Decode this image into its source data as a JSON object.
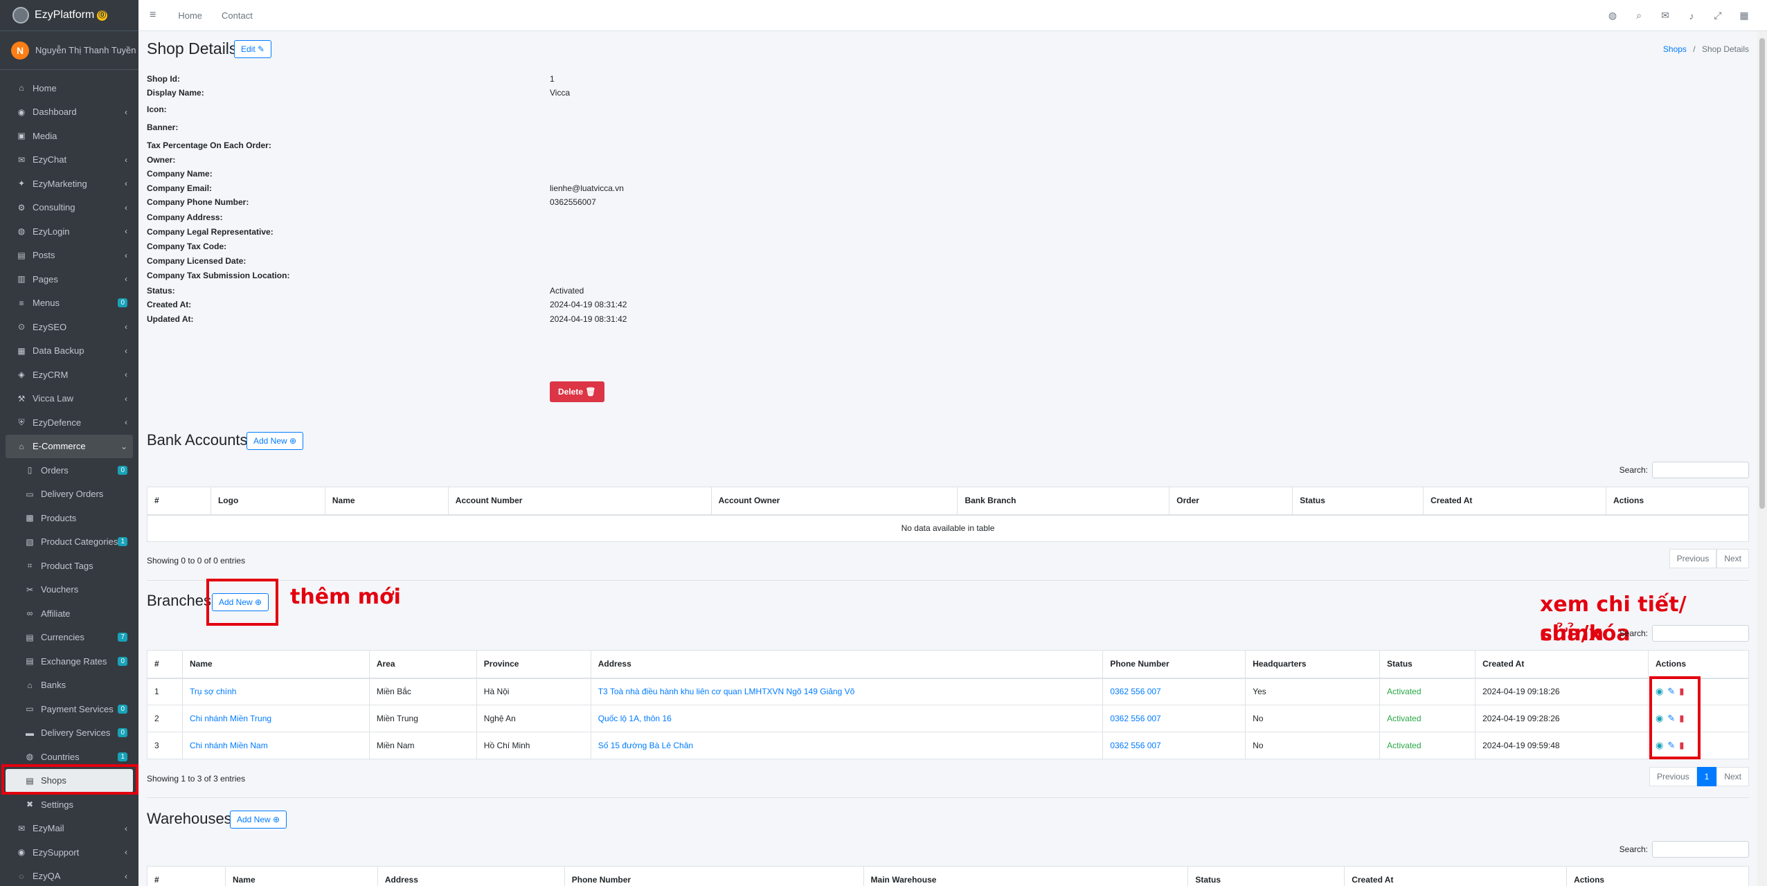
{
  "brand": {
    "name": "EzyPlatform",
    "badge": "⓪"
  },
  "user": {
    "initial": "N",
    "name": "Nguyễn Thị Thanh Tuyền"
  },
  "sidebar": [
    {
      "label": "Home",
      "icon": "home-icon",
      "glyph": "⌂",
      "type": "top"
    },
    {
      "label": "Dashboard",
      "icon": "dashboard-icon",
      "glyph": "◉",
      "type": "top",
      "chev": "‹"
    },
    {
      "label": "Media",
      "icon": "image-icon",
      "glyph": "▣",
      "type": "top"
    },
    {
      "label": "EzyChat",
      "icon": "chat-icon",
      "glyph": "✉",
      "type": "top",
      "chev": "‹"
    },
    {
      "label": "EzyMarketing",
      "icon": "megaphone-icon",
      "glyph": "✦",
      "type": "top",
      "chev": "‹"
    },
    {
      "label": "Consulting",
      "icon": "gear-icon",
      "glyph": "⚙",
      "type": "top",
      "chev": "‹"
    },
    {
      "label": "EzyLogin",
      "icon": "user-lock-icon",
      "glyph": "◍",
      "type": "top",
      "chev": "‹"
    },
    {
      "label": "Posts",
      "icon": "post-icon",
      "glyph": "▤",
      "type": "top",
      "chev": "‹"
    },
    {
      "label": "Pages",
      "icon": "pages-icon",
      "glyph": "▥",
      "type": "top",
      "chev": "‹"
    },
    {
      "label": "Menus",
      "icon": "menu-icon",
      "glyph": "≡",
      "type": "top",
      "badge": "0"
    },
    {
      "label": "EzySEO",
      "icon": "seo-search-icon",
      "glyph": "⊙",
      "type": "top",
      "chev": "‹"
    },
    {
      "label": "Data Backup",
      "icon": "database-icon",
      "glyph": "▦",
      "type": "top",
      "chev": "‹"
    },
    {
      "label": "EzyCRM",
      "icon": "crm-icon",
      "glyph": "◈",
      "type": "top",
      "chev": "‹"
    },
    {
      "label": "Vicca Law",
      "icon": "gavel-icon",
      "glyph": "⚒",
      "type": "top",
      "chev": "‹"
    },
    {
      "label": "EzyDefence",
      "icon": "shield-icon",
      "glyph": "⛨",
      "type": "top",
      "chev": "‹"
    },
    {
      "label": "E-Commerce",
      "icon": "shop-basket-icon",
      "glyph": "⌂",
      "type": "open",
      "chev": "⌄"
    },
    {
      "label": "Orders",
      "icon": "orders-icon",
      "glyph": "▯",
      "type": "sub",
      "badge": "0"
    },
    {
      "label": "Delivery Orders",
      "icon": "delivery-orders-icon",
      "glyph": "▭",
      "type": "sub"
    },
    {
      "label": "Products",
      "icon": "products-icon",
      "glyph": "▩",
      "type": "sub"
    },
    {
      "label": "Product Categories",
      "icon": "categories-icon",
      "glyph": "▧",
      "type": "sub",
      "badge": "1"
    },
    {
      "label": "Product Tags",
      "icon": "tag-icon",
      "glyph": "⌗",
      "type": "sub"
    },
    {
      "label": "Vouchers",
      "icon": "voucher-icon",
      "glyph": "✂",
      "type": "sub"
    },
    {
      "label": "Affiliate",
      "icon": "link-icon",
      "glyph": "∞",
      "type": "sub"
    },
    {
      "label": "Currencies",
      "icon": "currency-icon",
      "glyph": "▤",
      "type": "sub",
      "badge": "7"
    },
    {
      "label": "Exchange Rates",
      "icon": "exchange-icon",
      "glyph": "▤",
      "type": "sub",
      "badge": "0"
    },
    {
      "label": "Banks",
      "icon": "bank-icon",
      "glyph": "⌂",
      "type": "sub"
    },
    {
      "label": "Payment Services",
      "icon": "payment-icon",
      "glyph": "▭",
      "type": "sub",
      "badge": "0"
    },
    {
      "label": "Delivery Services",
      "icon": "truck-icon",
      "glyph": "▬",
      "type": "sub",
      "badge": "0"
    },
    {
      "label": "Countries",
      "icon": "globe-icon",
      "glyph": "◍",
      "type": "sub",
      "badge": "1"
    },
    {
      "label": "Shops",
      "icon": "store-icon",
      "glyph": "▤",
      "type": "active"
    },
    {
      "label": "Settings",
      "icon": "tools-icon",
      "glyph": "✖",
      "type": "sub"
    },
    {
      "label": "EzyMail",
      "icon": "mail-icon",
      "glyph": "✉",
      "type": "top",
      "chev": "‹"
    },
    {
      "label": "EzySupport",
      "icon": "support-icon",
      "glyph": "◉",
      "type": "top",
      "chev": "‹"
    },
    {
      "label": "EzyQA",
      "icon": "qa-icon",
      "glyph": "◌",
      "type": "top",
      "chev": "‹"
    }
  ],
  "topbar": {
    "home": "Home",
    "contact": "Contact"
  },
  "page": {
    "title": "Shop Details",
    "edit": "Edit ✎"
  },
  "breadcrumb": {
    "parent": "Shops",
    "separator": "/",
    "current": "Shop Details"
  },
  "details": [
    {
      "k": "Shop Id:",
      "v": "1"
    },
    {
      "k": "Display Name:",
      "v": "Vicca"
    },
    {
      "k": "Icon:",
      "v": ""
    },
    {
      "k": "Banner:",
      "v": ""
    },
    {
      "k": "Tax Percentage On Each Order:",
      "v": ""
    },
    {
      "k": "Owner:",
      "v": ""
    },
    {
      "k": "Company Name:",
      "v": ""
    },
    {
      "k": "Company Email:",
      "v": "lienhe@luatvicca.vn"
    },
    {
      "k": "Company Phone Number:",
      "v": "0362556007"
    },
    {
      "k": "Company Address:",
      "v": ""
    },
    {
      "k": "Company Legal Representative:",
      "v": ""
    },
    {
      "k": "Company Tax Code:",
      "v": ""
    },
    {
      "k": "Company Licensed Date:",
      "v": ""
    },
    {
      "k": "Company Tax Submission Location:",
      "v": ""
    },
    {
      "k": "Status:",
      "v": "Activated"
    },
    {
      "k": "Created At:",
      "v": "2024-04-19 08:31:42"
    },
    {
      "k": "Updated At:",
      "v": "2024-04-19 08:31:42"
    }
  ],
  "delete_label": "Delete 🗑",
  "common": {
    "add_new": "Add New ⊕",
    "search": "Search:",
    "previous": "Previous",
    "next": "Next"
  },
  "bank_accounts": {
    "title": "Bank Accounts",
    "columns": [
      "#",
      "Logo",
      "Name",
      "Account Number",
      "Account Owner",
      "Bank Branch",
      "Order",
      "Status",
      "Created At",
      "Actions"
    ],
    "empty": "No data available in table",
    "info": "Showing 0 to 0 of 0 entries"
  },
  "branches": {
    "title": "Branches",
    "columns": [
      "#",
      "Name",
      "Area",
      "Province",
      "Address",
      "Phone Number",
      "Headquarters",
      "Status",
      "Created At",
      "Actions"
    ],
    "rows": [
      [
        "1",
        "Trụ sợ chính",
        "Miền Bắc",
        "Hà Nội",
        "T3 Toà nhà điều hành khu liên cơ quan LMHTXVN Ngõ 149 Giảng Võ",
        "0362 556 007",
        "Yes",
        "Activated",
        "2024-04-19 09:18:26"
      ],
      [
        "2",
        "Chi nhánh Miền Trung",
        "Miền Trung",
        "Nghệ An",
        "Quốc lộ 1A, thôn 16",
        "0362 556 007",
        "No",
        "Activated",
        "2024-04-19 09:28:26"
      ],
      [
        "3",
        "Chi nhánh Miền Nam",
        "Miền Nam",
        "Hồ Chí Minh",
        "Số 15 đường Bà Lê Chân",
        "0362 556 007",
        "No",
        "Activated",
        "2024-04-19 09:59:48"
      ]
    ],
    "info": "Showing 1 to 3 of 3 entries",
    "page": "1"
  },
  "warehouses": {
    "title": "Warehouses",
    "columns": [
      "#",
      "Name",
      "Address",
      "Phone Number",
      "Main Warehouse",
      "Status",
      "Created At",
      "Actions"
    ]
  },
  "annotations": {
    "add": "thêm mới",
    "actions_line1": "xem chi tiết/ chỉnh",
    "actions_line2": "sửa/xóa"
  },
  "colors": {
    "sidebar": "#343a40",
    "primary": "#007bff",
    "danger": "#dc3545",
    "success": "#28a745",
    "annotation": "#e3000f"
  }
}
